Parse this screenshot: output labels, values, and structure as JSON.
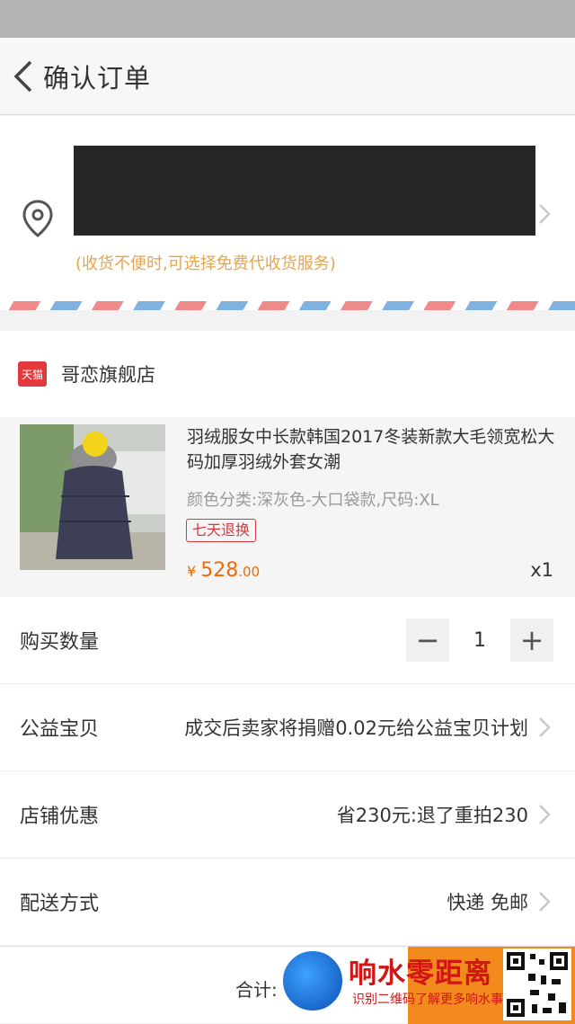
{
  "header": {
    "title": "确认订单"
  },
  "address": {
    "hint": "(收货不便时,可选择免费代收货服务)"
  },
  "shop": {
    "badge": "天猫",
    "name": "哥恋旗舰店"
  },
  "product": {
    "title": "羽绒服女中长款韩国2017冬装新款大毛领宽松大码加厚羽绒外套女潮",
    "sku": "颜色分类:深灰色-大口袋款,尺码:XL",
    "tag": "七天退换",
    "price_symbol": "¥",
    "price_int": "528",
    "price_dec": ".00",
    "quantity_label": "x1"
  },
  "rows": {
    "quantity": {
      "label": "购买数量",
      "value": "1",
      "minus": "−",
      "plus": "+"
    },
    "charity": {
      "label": "公益宝贝",
      "value": "成交后卖家将捐赠0.02元给公益宝贝计划"
    },
    "discount": {
      "label": "店铺优惠",
      "value": "省230元:退了重拍230"
    },
    "delivery": {
      "label": "配送方式",
      "value": "快递 免邮"
    }
  },
  "footer": {
    "total_label": "合计:"
  },
  "watermark": {
    "title": "响水零距离",
    "subtitle": "识别二维码了解更多响水事"
  },
  "colors": {
    "accent": "#f26a00",
    "tmall": "#e4393c",
    "hint": "#e7a54b"
  }
}
